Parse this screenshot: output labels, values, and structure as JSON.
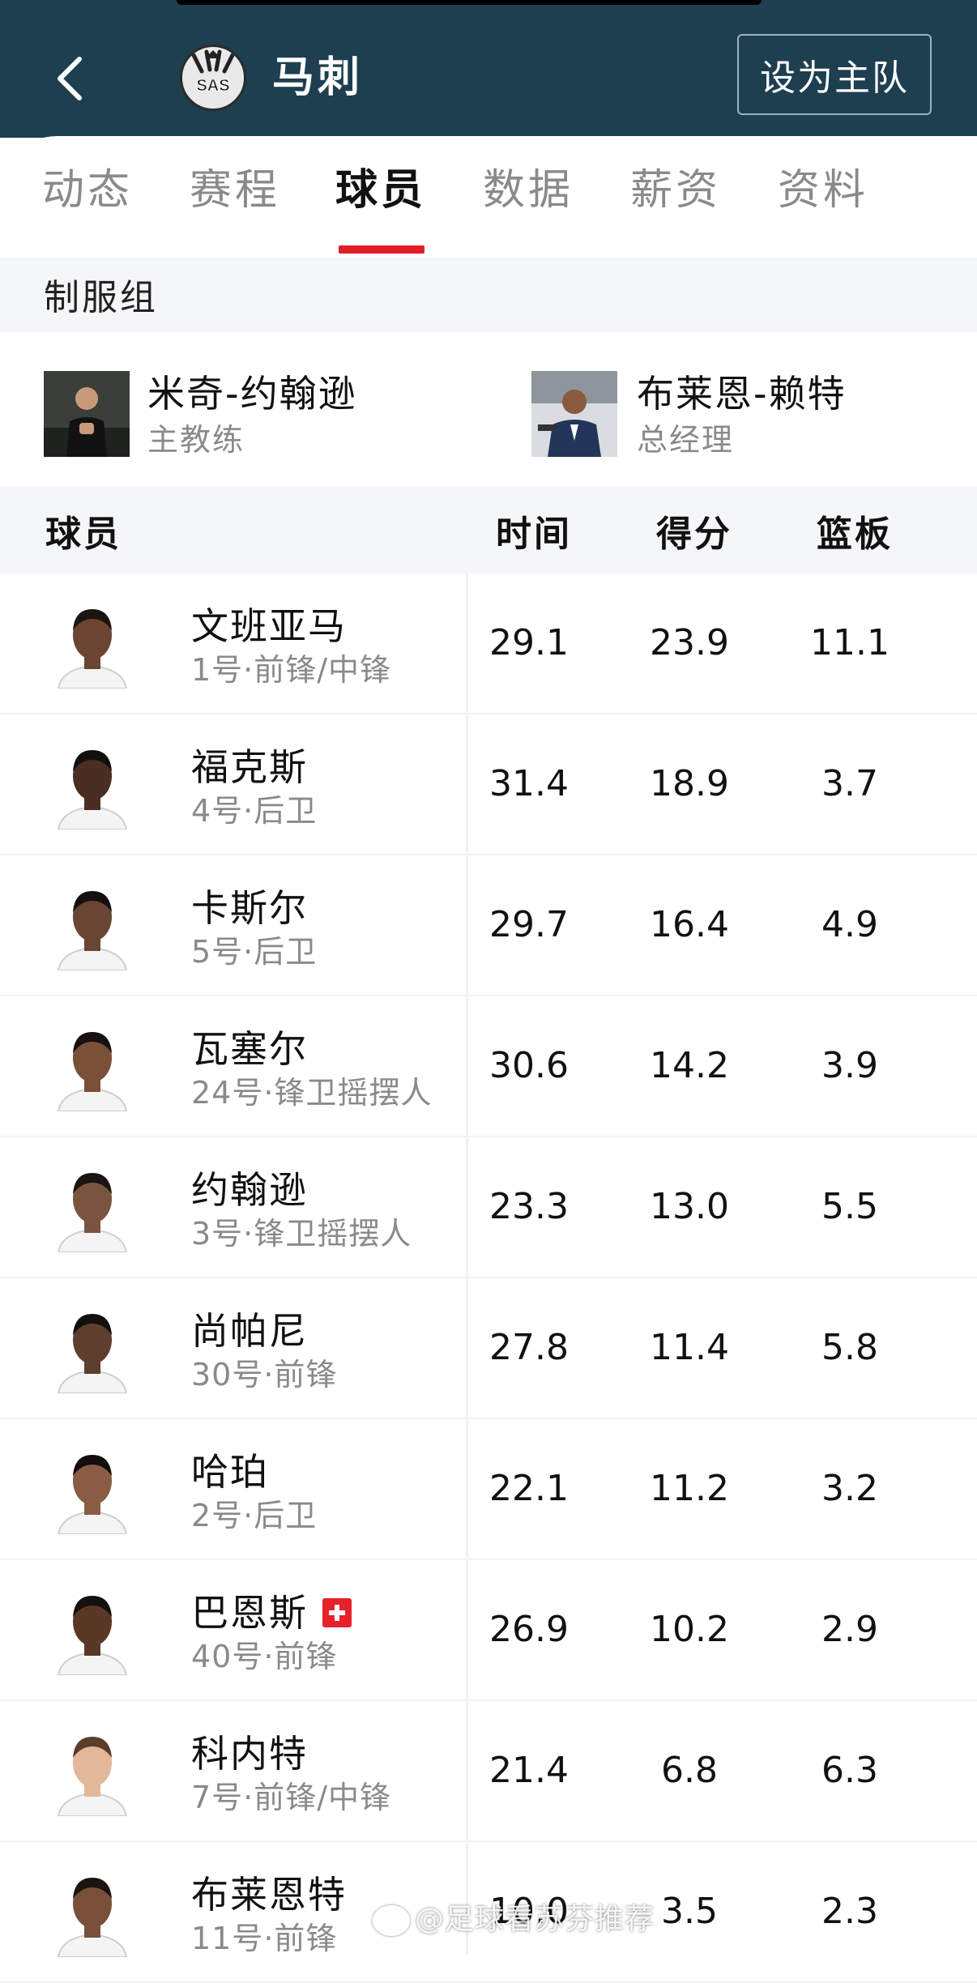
{
  "header": {
    "team_name": "马刺",
    "logo_text": "SAS",
    "set_home_label": "设为主队"
  },
  "tabs": [
    {
      "label": "动态"
    },
    {
      "label": "赛程"
    },
    {
      "label": "球员"
    },
    {
      "label": "数据"
    },
    {
      "label": "薪资"
    },
    {
      "label": "资料"
    }
  ],
  "active_tab": "球员",
  "staff": {
    "section_title": "制服组",
    "members": [
      {
        "name": "米奇-约翰逊",
        "role": "主教练"
      },
      {
        "name": "布莱恩-赖特",
        "role": "总经理"
      }
    ]
  },
  "table": {
    "headers": {
      "player": "球员",
      "time": "时间",
      "points": "得分",
      "rebounds": "篮板"
    },
    "rows": [
      {
        "name": "文班亚马",
        "info": "1号·前锋/中锋",
        "time": "29.1",
        "points": "23.9",
        "rebounds": "11.1",
        "injured": false
      },
      {
        "name": "福克斯",
        "info": "4号·后卫",
        "time": "31.4",
        "points": "18.9",
        "rebounds": "3.7",
        "injured": false
      },
      {
        "name": "卡斯尔",
        "info": "5号·后卫",
        "time": "29.7",
        "points": "16.4",
        "rebounds": "4.9",
        "injured": false
      },
      {
        "name": "瓦塞尔",
        "info": "24号·锋卫摇摆人",
        "time": "30.6",
        "points": "14.2",
        "rebounds": "3.9",
        "injured": false
      },
      {
        "name": "约翰逊",
        "info": "3号·锋卫摇摆人",
        "time": "23.3",
        "points": "13.0",
        "rebounds": "5.5",
        "injured": false
      },
      {
        "name": "尚帕尼",
        "info": "30号·前锋",
        "time": "27.8",
        "points": "11.4",
        "rebounds": "5.8",
        "injured": false
      },
      {
        "name": "哈珀",
        "info": "2号·后卫",
        "time": "22.1",
        "points": "11.2",
        "rebounds": "3.2",
        "injured": false
      },
      {
        "name": "巴恩斯",
        "info": "40号·前锋",
        "time": "26.9",
        "points": "10.2",
        "rebounds": "2.9",
        "injured": true
      },
      {
        "name": "科内特",
        "info": "7号·前锋/中锋",
        "time": "21.4",
        "points": "6.8",
        "rebounds": "6.3",
        "injured": false
      },
      {
        "name": "布莱恩特",
        "info": "11号·前锋",
        "time": "10.0",
        "points": "3.5",
        "rebounds": "2.3",
        "injured": false
      }
    ]
  },
  "watermark": "@足球看苏芬推荐",
  "colors": {
    "header_bg": "#1d3f50",
    "accent_red": "#e01f2b",
    "muted_text": "#8a8a8a",
    "band_bg": "#f5f6f8"
  }
}
